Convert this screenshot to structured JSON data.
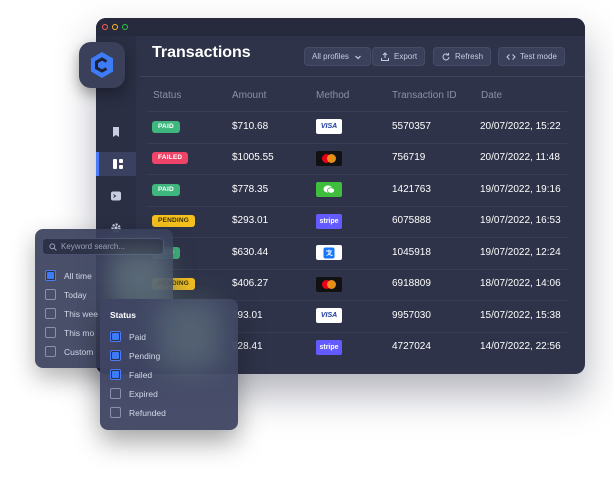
{
  "window": {
    "dots": [
      "close",
      "minimize",
      "maximize"
    ]
  },
  "header": {
    "title": "Transactions",
    "profile_filter": "All profiles",
    "export_label": "Export",
    "refresh_label": "Refresh",
    "testmode_label": "Test mode"
  },
  "sidebar": {
    "items": [
      {
        "icon": "bookmark-icon"
      },
      {
        "icon": "dashboard-icon",
        "active": true
      },
      {
        "icon": "terminal-icon"
      },
      {
        "icon": "gear-icon"
      }
    ]
  },
  "table": {
    "columns": [
      "Status",
      "Amount",
      "Method",
      "Transaction ID",
      "Date"
    ],
    "rows": [
      {
        "status": "PAID",
        "amount": "$710.68",
        "method": "visa",
        "method_label": "VISA",
        "id": "5570357",
        "date": "20/07/2022, 15:22"
      },
      {
        "status": "FAILED",
        "amount": "$1005.55",
        "method": "mastercard",
        "method_label": "",
        "id": "756719",
        "date": "20/07/2022, 11:48"
      },
      {
        "status": "PAID",
        "amount": "$778.35",
        "method": "wechat",
        "method_label": "",
        "id": "1421763",
        "date": "19/07/2022, 19:16"
      },
      {
        "status": "PENDING",
        "amount": "$293.01",
        "method": "stripe",
        "method_label": "stripe",
        "id": "6075888",
        "date": "19/07/2022, 16:53"
      },
      {
        "status": "PAID",
        "amount": "$630.44",
        "method": "alipay",
        "method_label": "",
        "id": "1045918",
        "date": "19/07/2022, 12:24"
      },
      {
        "status": "PENDING",
        "amount": "$406.27",
        "method": "mastercard",
        "method_label": "",
        "id": "6918809",
        "date": "18/07/2022, 14:06"
      },
      {
        "status": "",
        "amount": "293.01",
        "method": "visa",
        "method_label": "VISA",
        "id": "9957030",
        "date": "15/07/2022, 15:38"
      },
      {
        "status": "",
        "amount": "928.41",
        "method": "stripe",
        "method_label": "stripe",
        "id": "4727024",
        "date": "14/07/2022, 22:56"
      }
    ]
  },
  "date_filter": {
    "search_placeholder": "Keyword search...",
    "options": [
      {
        "label": "All time",
        "checked": true
      },
      {
        "label": "Today",
        "checked": false
      },
      {
        "label": "This wee",
        "checked": false
      },
      {
        "label": "This mo",
        "checked": false
      },
      {
        "label": "Custom",
        "checked": false
      }
    ]
  },
  "status_filter": {
    "title": "Status",
    "options": [
      {
        "label": "Paid",
        "checked": true
      },
      {
        "label": "Pending",
        "checked": true
      },
      {
        "label": "Failed",
        "checked": true
      },
      {
        "label": "Expired",
        "checked": false
      },
      {
        "label": "Refunded",
        "checked": false
      }
    ]
  },
  "colors": {
    "paid": "#3fb67d",
    "failed": "#ee4467",
    "pending": "#f4c01e",
    "accent": "#4b7cf6"
  }
}
